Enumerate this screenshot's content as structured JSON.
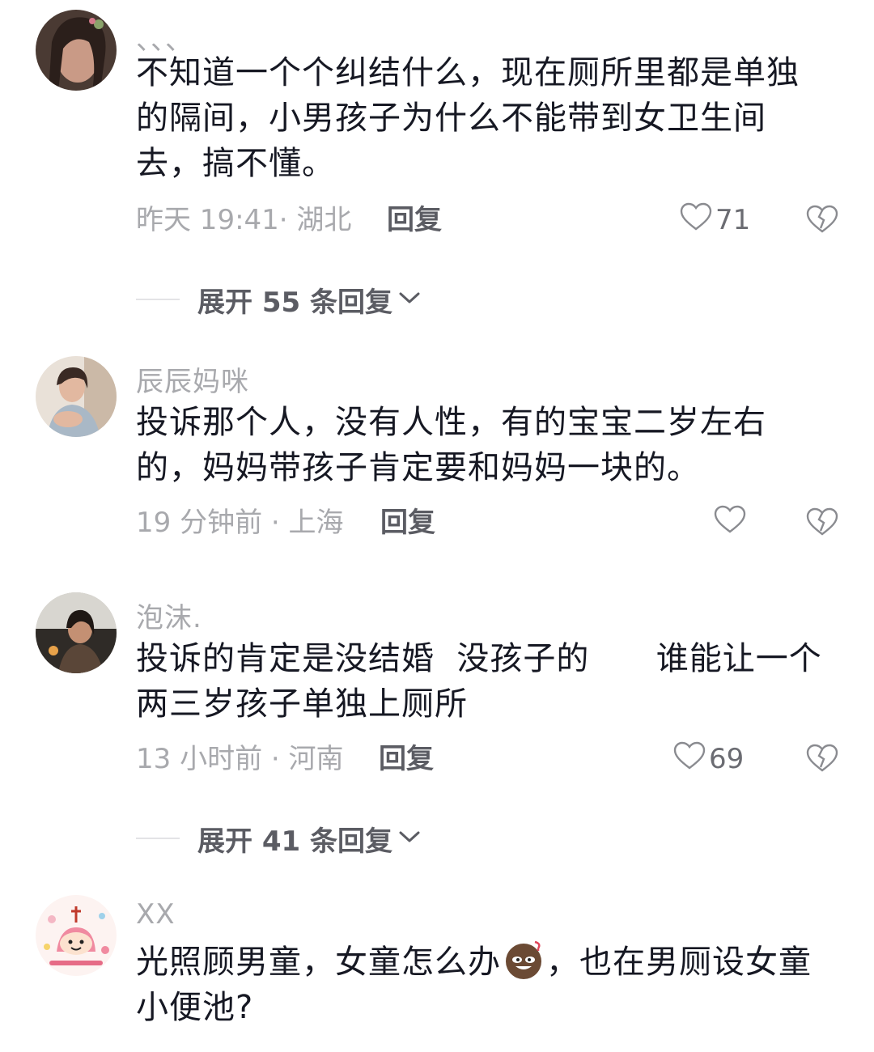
{
  "comments": [
    {
      "username": "、、、",
      "lines": [
        "不知道一个个纠结什么，现在厕所里都是单独",
        "的隔间，小男孩子为什么不能带到女卫生间",
        "去，搞不懂。"
      ],
      "meta": "昨天 19:41· 湖北",
      "reply_label": "回复",
      "like_count": "71",
      "expand_label": "展开 55 条回复"
    },
    {
      "username": "辰辰妈咪",
      "lines": [
        "投诉那个人，没有人性，有的宝宝二岁左右",
        "的，妈妈带孩子肯定要和妈妈一块的。"
      ],
      "meta": "19 分钟前 · 上海",
      "reply_label": "回复",
      "like_count": ""
    },
    {
      "username": "泡沫.",
      "lines": [
        "投诉的肯定是没结婚  没孩子的      谁能让一个",
        "两三岁孩子单独上厕所"
      ],
      "meta": "13 小时前 · 河南",
      "reply_label": "回复",
      "like_count": "69",
      "expand_label": "展开 41 条回复"
    },
    {
      "username": "XX",
      "line1_a": "光照顾男童，女童怎么办",
      "line1_b": "，也在男厕设女童",
      "line2": "小便池?",
      "emoji": "laughing-face-emoji"
    }
  ],
  "icons": {
    "like": "heart-outline-icon",
    "dislike": "broken-heart-icon",
    "expand": "chevron-down-icon"
  },
  "colors": {
    "text": "#161823",
    "muted": "#a8a9ad",
    "reply": "#5b5c63"
  }
}
